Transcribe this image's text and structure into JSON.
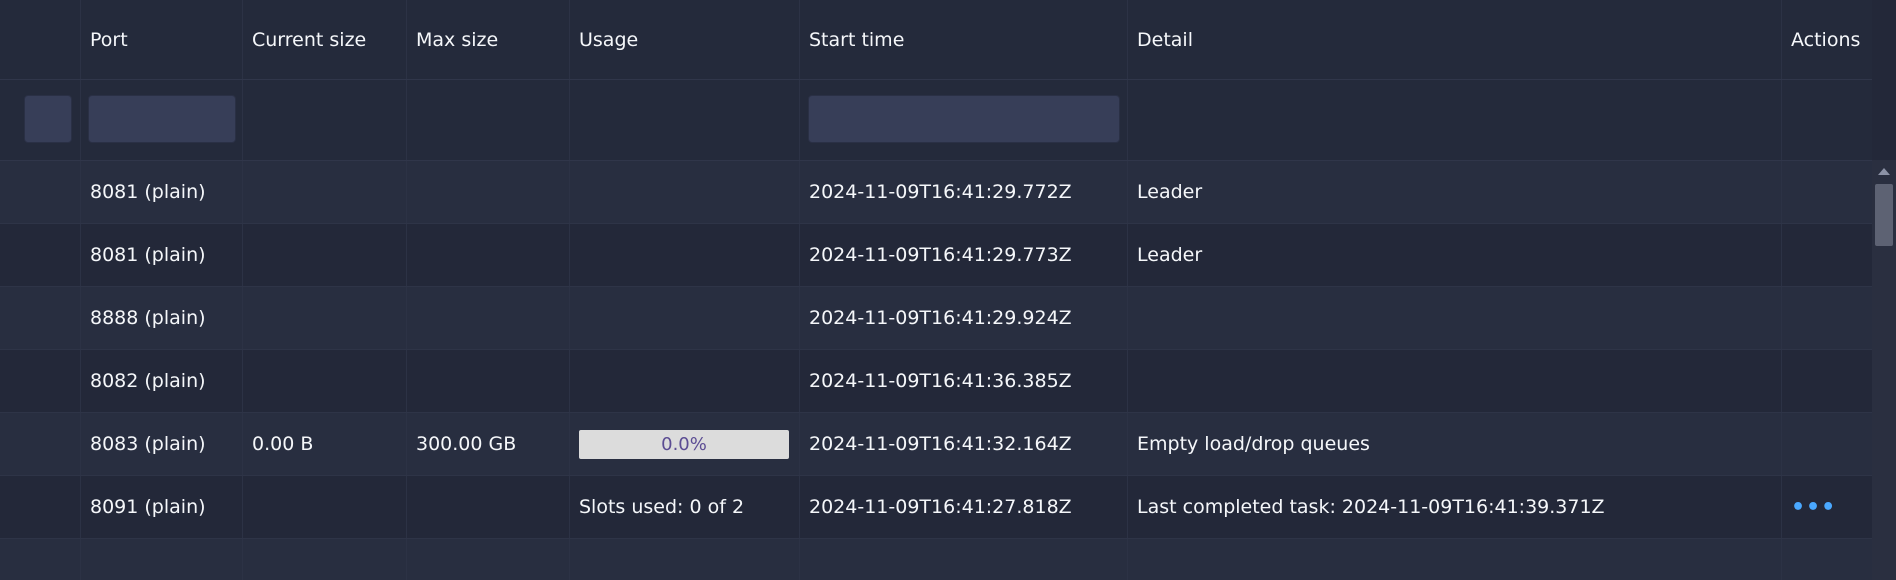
{
  "columns": {
    "port": "Port",
    "current_size": "Current size",
    "max_size": "Max size",
    "usage": "Usage",
    "start_time": "Start time",
    "detail": "Detail",
    "actions": "Actions"
  },
  "rows": [
    {
      "port": "8081 (plain)",
      "current_size": "",
      "max_size": "",
      "usage": "",
      "start_time": "2024-11-09T16:41:29.772Z",
      "detail": "Leader"
    },
    {
      "port": "8081 (plain)",
      "current_size": "",
      "max_size": "",
      "usage": "",
      "start_time": "2024-11-09T16:41:29.773Z",
      "detail": "Leader"
    },
    {
      "port": "8888 (plain)",
      "current_size": "",
      "max_size": "",
      "usage": "",
      "start_time": "2024-11-09T16:41:29.924Z",
      "detail": ""
    },
    {
      "port": "8082 (plain)",
      "current_size": "",
      "max_size": "",
      "usage": "",
      "start_time": "2024-11-09T16:41:36.385Z",
      "detail": ""
    },
    {
      "port": "8083 (plain)",
      "current_size": "0.00 B",
      "max_size": "300.00 GB",
      "usage_percent": 0.0,
      "usage_label": "0.0%",
      "start_time": "2024-11-09T16:41:32.164Z",
      "detail": "Empty load/drop queues"
    },
    {
      "port": "8091 (plain)",
      "current_size": "",
      "max_size": "",
      "usage": "Slots used: 0 of 2",
      "start_time": "2024-11-09T16:41:27.818Z",
      "detail": "Last completed task: 2024-11-09T16:41:39.371Z",
      "actions_icon": "more-horizontal-icon"
    }
  ],
  "colors": {
    "background": "#232839",
    "accent": "#4aa8ff",
    "progress_track": "#dcdcdc",
    "progress_text": "#5b4c93"
  }
}
